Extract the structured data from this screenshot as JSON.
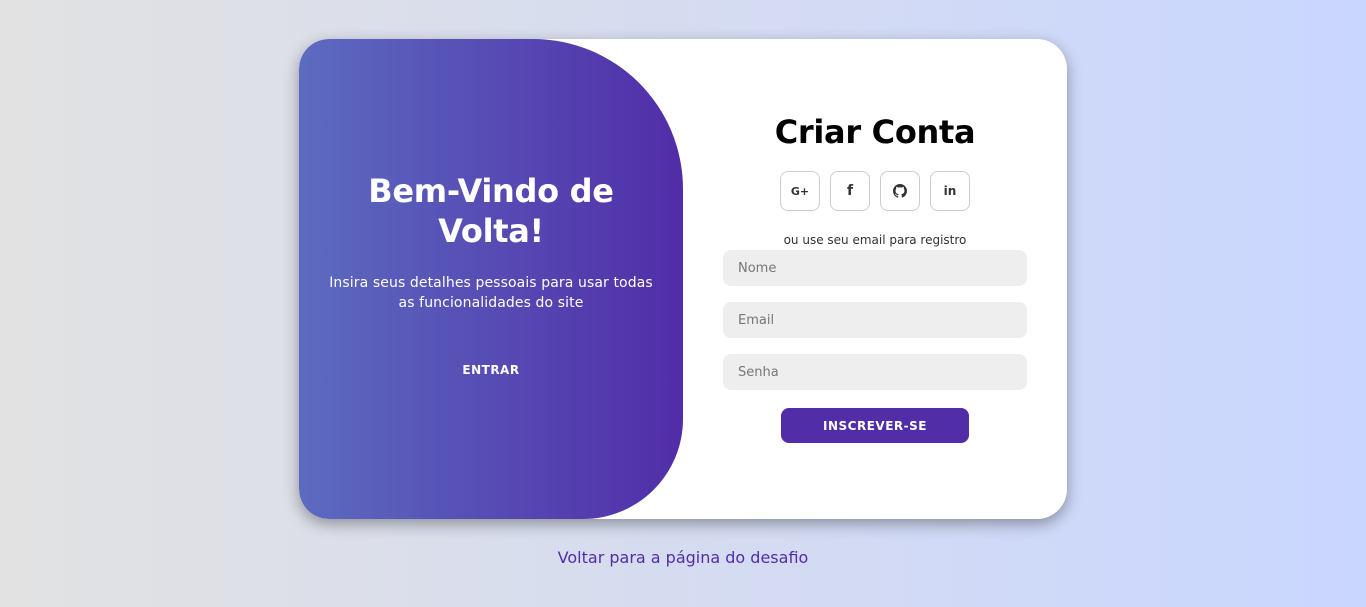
{
  "toggle": {
    "title": "Bem-Vindo de Volta!",
    "text": "Insira seus detalhes pessoais para usar todas as funcionalidades do site",
    "button_label": "Entrar"
  },
  "signup": {
    "title": "Criar Conta",
    "social": [
      {
        "icon": "google-plus-icon",
        "glyph": "G+"
      },
      {
        "icon": "facebook-icon",
        "glyph": "f"
      },
      {
        "icon": "github-icon",
        "glyph": ""
      },
      {
        "icon": "linkedin-icon",
        "glyph": "in"
      }
    ],
    "alt_text": "ou use seu email para registro",
    "name_placeholder": "Nome",
    "email_placeholder": "Email",
    "password_placeholder": "Senha",
    "submit_label": "Inscrever-se"
  },
  "footer": {
    "back_link": "Voltar para a página do desafio"
  },
  "colors": {
    "accent": "#512da8",
    "gradient_start": "#5c6bc0",
    "background_start": "#e2e2e2",
    "background_end": "#c9d6ff",
    "input_bg": "#eeeeee"
  }
}
